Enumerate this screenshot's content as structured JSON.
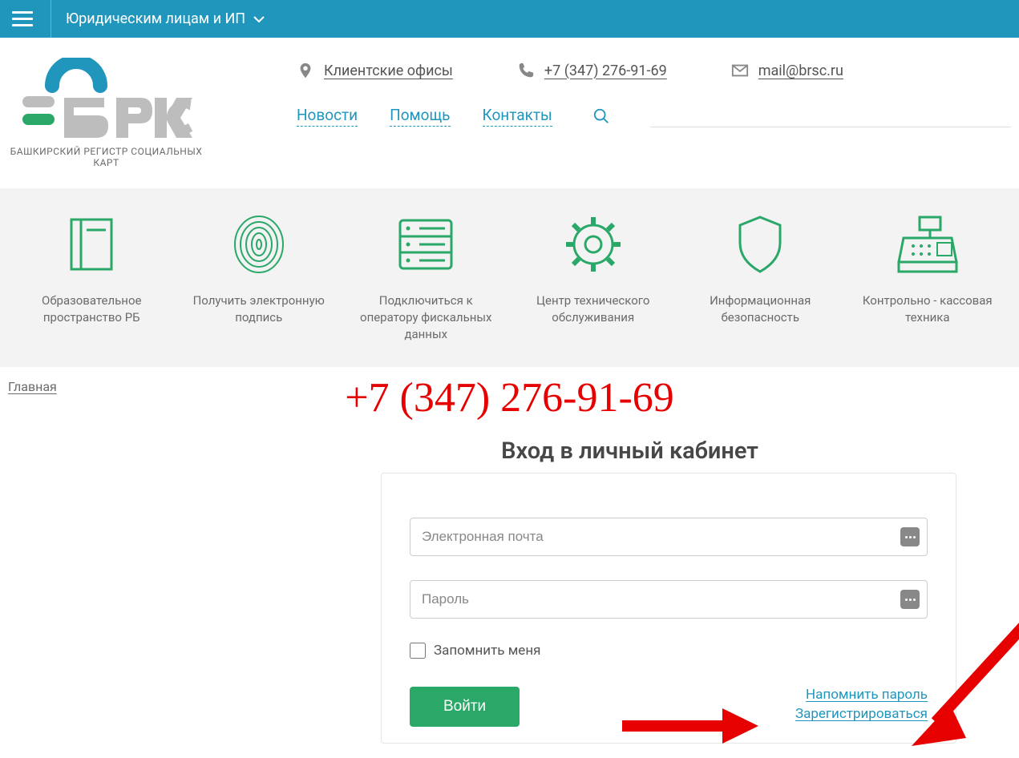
{
  "topbar": {
    "dropdown_label": "Юридическим лицам и ИП"
  },
  "logo": {
    "subtitle": "БАШКИРСКИЙ РЕГИСТР СОЦИАЛЬНЫХ КАРТ"
  },
  "contacts": {
    "offices": "Клиентские офисы",
    "phone": "+7 (347) 276-91-69",
    "email": "mail@brsc.ru"
  },
  "nav": {
    "news": "Новости",
    "help": "Помощь",
    "contacts": "Контакты"
  },
  "services": [
    {
      "label": "Образовательное пространство РБ"
    },
    {
      "label": "Получить электронную подпись"
    },
    {
      "label": "Подключиться к оператору фискальных данных"
    },
    {
      "label": "Центр технического обслуживания"
    },
    {
      "label": "Информационная безопасность"
    },
    {
      "label": "Контрольно - кассовая техника"
    }
  ],
  "breadcrumb": {
    "home": "Главная"
  },
  "big_phone": "+7 (347) 276-91-69",
  "login": {
    "title": "Вход в личный кабинет",
    "email_placeholder": "Электронная почта",
    "password_placeholder": "Пароль",
    "remember": "Запомнить меня",
    "submit": "Войти",
    "remind": "Напомнить пароль",
    "register": "Зарегистрироваться"
  }
}
